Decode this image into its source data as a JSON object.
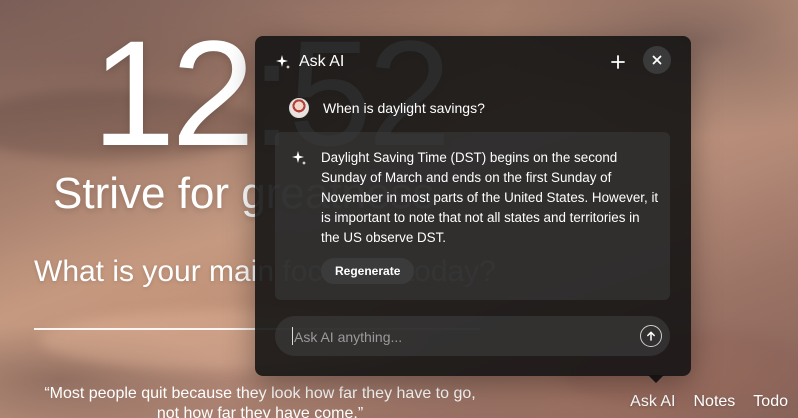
{
  "background": {
    "clock": "12:52",
    "greeting": "Strive for greatness",
    "focus_question": "What is your main focus for today?",
    "quote": "“Most people quit because they look how far they have to go, not how far they have come.”"
  },
  "bottom_nav": {
    "items": [
      "Ask AI",
      "Notes",
      "Todo"
    ]
  },
  "ask_ai": {
    "title": "Ask AI",
    "user_message": "When is daylight savings?",
    "answer": "Daylight Saving Time (DST) begins on the second Sunday of March and ends on the first Sunday of November in most parts of the United States. However, it is important to note that not all states and territories in the US observe DST.",
    "regenerate_label": "Regenerate",
    "input_placeholder": "Ask AI anything..."
  },
  "icons": {
    "title": "sparkle-icon",
    "new": "plus-icon",
    "close": "close-icon",
    "answer": "sparkle-icon",
    "send": "arrow-up-icon"
  }
}
